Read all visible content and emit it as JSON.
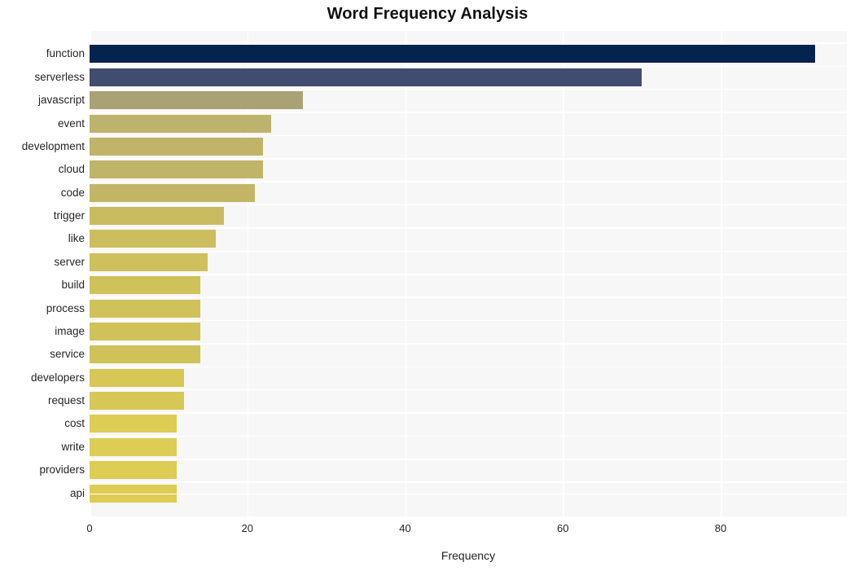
{
  "chart_data": {
    "type": "bar",
    "orientation": "horizontal",
    "title": "Word Frequency Analysis",
    "xlabel": "Frequency",
    "ylabel": "",
    "categories": [
      "function",
      "serverless",
      "javascript",
      "event",
      "development",
      "cloud",
      "code",
      "trigger",
      "like",
      "server",
      "build",
      "process",
      "image",
      "service",
      "developers",
      "request",
      "cost",
      "write",
      "providers",
      "api"
    ],
    "values": [
      92,
      70,
      27,
      23,
      22,
      22,
      21,
      17,
      16,
      15,
      14,
      14,
      14,
      14,
      12,
      12,
      11,
      11,
      11,
      11
    ],
    "bar_colors": [
      "#04234f",
      "#414d70",
      "#a9a274",
      "#bdb36c",
      "#bfb468",
      "#bfb468",
      "#c2b666",
      "#c9bc60",
      "#ccbe5e",
      "#cec05c",
      "#d0c25a",
      "#d0c25a",
      "#d0c25a",
      "#d0c25a",
      "#d6c757",
      "#d6c757",
      "#ddcd54",
      "#ddcd54",
      "#ddcd54",
      "#ddcd54"
    ],
    "xticks": [
      0,
      20,
      40,
      60,
      80
    ],
    "xlim": [
      0,
      96
    ],
    "grid": true,
    "grid_color": "#ffffff",
    "plot_background": "#f7f7f7",
    "figure_background": "#ffffff",
    "legend": null
  },
  "axes": {
    "x_tick_labels": [
      "0",
      "20",
      "40",
      "60",
      "80"
    ],
    "x_axis_title": "Frequency"
  },
  "header": {
    "title": "Word Frequency Analysis"
  }
}
